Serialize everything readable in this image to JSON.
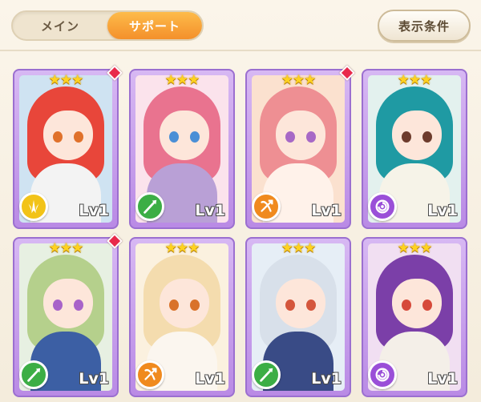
{
  "tabs": [
    {
      "label": "メイン",
      "active": false
    },
    {
      "label": "サポート",
      "active": true
    }
  ],
  "filter_button": {
    "label": "表示条件"
  },
  "cards": [
    {
      "stars": "★★★",
      "level": "Lv1",
      "element": "wind",
      "badge_color": "#f2c318",
      "gem": true,
      "palette": {
        "bg": "#cfe3f2",
        "hair": "#e8463a",
        "eye": "#e0712b",
        "body": "#f3f3f3"
      }
    },
    {
      "stars": "★★★",
      "level": "Lv1",
      "element": "forest",
      "badge_color": "#3cae45",
      "gem": false,
      "palette": {
        "bg": "#fbe3ec",
        "hair": "#e9738f",
        "eye": "#4a8fd6",
        "body": "#b9a0d6"
      }
    },
    {
      "stars": "★★★",
      "level": "Lv1",
      "element": "fire",
      "badge_color": "#f08a1e",
      "gem": true,
      "palette": {
        "bg": "#fbe1cf",
        "hair": "#ee8f93",
        "eye": "#a768c6",
        "body": "#fff2ea"
      }
    },
    {
      "stars": "★★★",
      "level": "Lv1",
      "element": "dark",
      "badge_color": "#9a4fd8",
      "gem": false,
      "palette": {
        "bg": "#e3f1ee",
        "hair": "#1f9aa3",
        "eye": "#6d3b2c",
        "body": "#f6f3e8"
      }
    },
    {
      "stars": "★★★",
      "level": "Lv1",
      "element": "forest",
      "badge_color": "#3cae45",
      "gem": true,
      "palette": {
        "bg": "#e7f0e2",
        "hair": "#b5d08c",
        "eye": "#a863c9",
        "body": "#3c5fa4"
      }
    },
    {
      "stars": "★★★",
      "level": "Lv1",
      "element": "fire",
      "badge_color": "#f08a1e",
      "gem": false,
      "palette": {
        "bg": "#fbf1df",
        "hair": "#f4dcae",
        "eye": "#d9722a",
        "body": "#fbf6ef"
      }
    },
    {
      "stars": "★★★",
      "level": "Lv1",
      "element": "forest",
      "badge_color": "#3cae45",
      "gem": false,
      "palette": {
        "bg": "#e6eef6",
        "hair": "#d8e0ea",
        "eye": "#d4563c",
        "body": "#394b86"
      }
    },
    {
      "stars": "★★★",
      "level": "Lv1",
      "element": "dark",
      "badge_color": "#9a4fd8",
      "gem": false,
      "palette": {
        "bg": "#f1dff2",
        "hair": "#7b3fa8",
        "eye": "#d6493a",
        "body": "#f4efe8"
      }
    }
  ]
}
